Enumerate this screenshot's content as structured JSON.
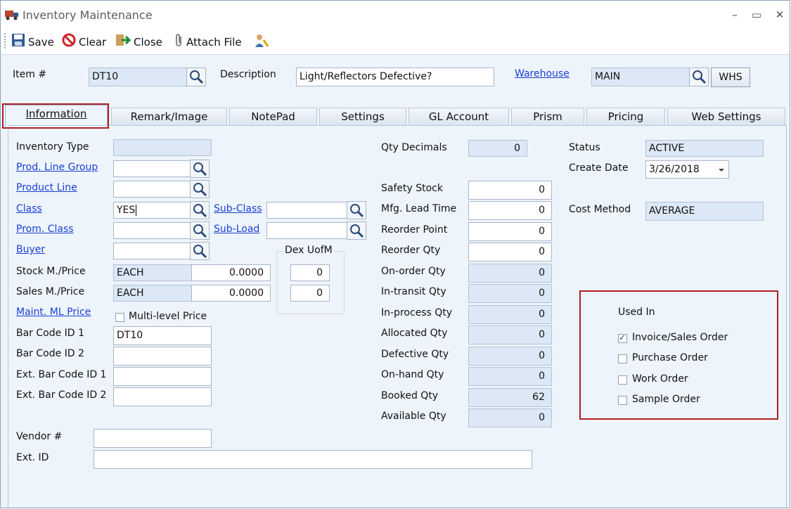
{
  "window": {
    "title": "Inventory Maintenance",
    "minimize": "–",
    "maximize": "▭",
    "close": "✕"
  },
  "toolbar": {
    "save": "Save",
    "clear": "Clear",
    "close": "Close",
    "attach": "Attach File"
  },
  "header": {
    "item_label": "Item #",
    "item_value": "DT10",
    "desc_label": "Description",
    "desc_value": "Light/Reflectors Defective?",
    "warehouse_label": "Warehouse",
    "warehouse_value": "MAIN",
    "whs_button": "WHS"
  },
  "tabs": [
    {
      "label": "Information"
    },
    {
      "label": "Remark/Image"
    },
    {
      "label": "NotePad"
    },
    {
      "label": "Settings"
    },
    {
      "label": "GL Account"
    },
    {
      "label": "Prism"
    },
    {
      "label": "Pricing"
    },
    {
      "label": "Web Settings"
    }
  ],
  "left": {
    "inventory_type": {
      "label": "Inventory Type",
      "value": ""
    },
    "prod_line_group": {
      "label": "Prod. Line Group",
      "value": ""
    },
    "product_line": {
      "label": "Product Line",
      "value": ""
    },
    "class": {
      "label": "Class",
      "value": "YES"
    },
    "sub_class": {
      "label": "Sub-Class",
      "value": ""
    },
    "prom_class": {
      "label": "Prom. Class",
      "value": ""
    },
    "sub_load": {
      "label": "Sub-Load",
      "value": ""
    },
    "buyer": {
      "label": "Buyer",
      "value": ""
    },
    "stock_m_price": {
      "label": "Stock M./Price",
      "unit": "EACH",
      "value": "0.0000"
    },
    "sales_m_price": {
      "label": "Sales M./Price",
      "unit": "EACH",
      "value": "0.0000"
    },
    "maint_ml_price": {
      "label": "Maint. ML Price"
    },
    "multi_level_price": {
      "label": "Multi-level Price",
      "checked": false
    },
    "dex_uofm": {
      "label": "Dex UofM",
      "stock": "0",
      "sales": "0"
    },
    "bar_code_1": {
      "label": "Bar Code ID 1",
      "value": "DT10"
    },
    "bar_code_2": {
      "label": "Bar Code ID 2",
      "value": ""
    },
    "ext_bar_code_1": {
      "label": "Ext. Bar Code ID 1",
      "value": ""
    },
    "ext_bar_code_2": {
      "label": "Ext. Bar Code ID 2",
      "value": ""
    },
    "vendor": {
      "label": "Vendor #",
      "value": ""
    },
    "ext_id": {
      "label": "Ext. ID",
      "value": ""
    }
  },
  "middle": {
    "qty_decimals": {
      "label": "Qty Decimals",
      "value": "0"
    },
    "safety_stock": {
      "label": "Safety Stock",
      "value": "0"
    },
    "mfg_lead_time": {
      "label": "Mfg. Lead Time",
      "value": "0"
    },
    "reorder_point": {
      "label": "Reorder Point",
      "value": "0"
    },
    "reorder_qty": {
      "label": "Reorder Qty",
      "value": "0"
    },
    "on_order_qty": {
      "label": "On-order Qty",
      "value": "0"
    },
    "in_transit_qty": {
      "label": "In-transit Qty",
      "value": "0"
    },
    "in_process_qty": {
      "label": "In-process Qty",
      "value": "0"
    },
    "allocated_qty": {
      "label": "Allocated Qty",
      "value": "0"
    },
    "defective_qty": {
      "label": "Defective Qty",
      "value": "0"
    },
    "on_hand_qty": {
      "label": "On-hand Qty",
      "value": "0"
    },
    "booked_qty": {
      "label": "Booked Qty",
      "value": "62"
    },
    "available_qty": {
      "label": "Available Qty",
      "value": "0"
    }
  },
  "right": {
    "status": {
      "label": "Status",
      "value": "ACTIVE"
    },
    "create_date": {
      "label": "Create Date",
      "value": "3/26/2018"
    },
    "cost_method": {
      "label": "Cost Method",
      "value": "AVERAGE"
    },
    "used_in": {
      "title": "Used In",
      "items": [
        {
          "label": "Invoice/Sales Order",
          "checked": true
        },
        {
          "label": "Purchase Order",
          "checked": false
        },
        {
          "label": "Work Order",
          "checked": false
        },
        {
          "label": "Sample Order",
          "checked": false
        }
      ]
    }
  },
  "colors": {
    "link": "#1a3fd6",
    "highlight_border": "#b01e24",
    "readonly_bg": "#dce8f5"
  }
}
